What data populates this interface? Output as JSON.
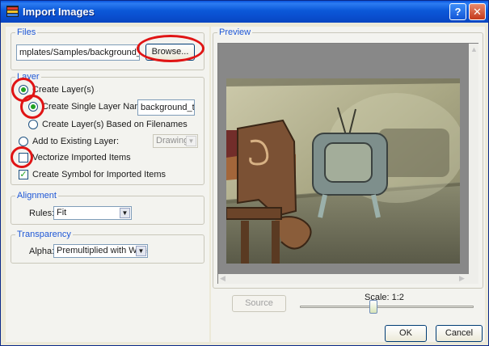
{
  "window": {
    "title": "Import Images",
    "help": "?",
    "close": "✕"
  },
  "files": {
    "legend": "Files",
    "path": "mplates/Samples/background_tv.psd",
    "browse_label": "Browse..."
  },
  "layer": {
    "legend": "Layer",
    "create_layers": "Create Layer(s)",
    "create_single": "Create Single Layer Named:",
    "single_name": "background_tv",
    "based_on_filenames": "Create Layer(s) Based on Filenames",
    "add_existing": "Add to Existing Layer:",
    "existing_value": "Drawing",
    "vectorize": "Vectorize Imported Items",
    "create_symbol": "Create Symbol for Imported Items"
  },
  "alignment": {
    "legend": "Alignment",
    "rules_label": "Rules:",
    "rules_value": "Fit"
  },
  "transparency": {
    "legend": "Transparency",
    "alpha_label": "Alpha:",
    "alpha_value": "Premultiplied with White"
  },
  "preview": {
    "legend": "Preview",
    "source_label": "Source",
    "scale_label": "Scale: 1:2"
  },
  "scale_slider": {
    "min": 0,
    "max": 1,
    "value": 0.42
  },
  "buttons": {
    "ok": "OK",
    "cancel": "Cancel"
  },
  "state": {
    "create_layers_selected": true,
    "create_single_selected": true,
    "vectorize_checked": false,
    "create_symbol_checked": true
  },
  "colors": {
    "title_bar": "#0a55de",
    "legend_blue": "#1e57d6",
    "annotation_red": "#e01414"
  }
}
